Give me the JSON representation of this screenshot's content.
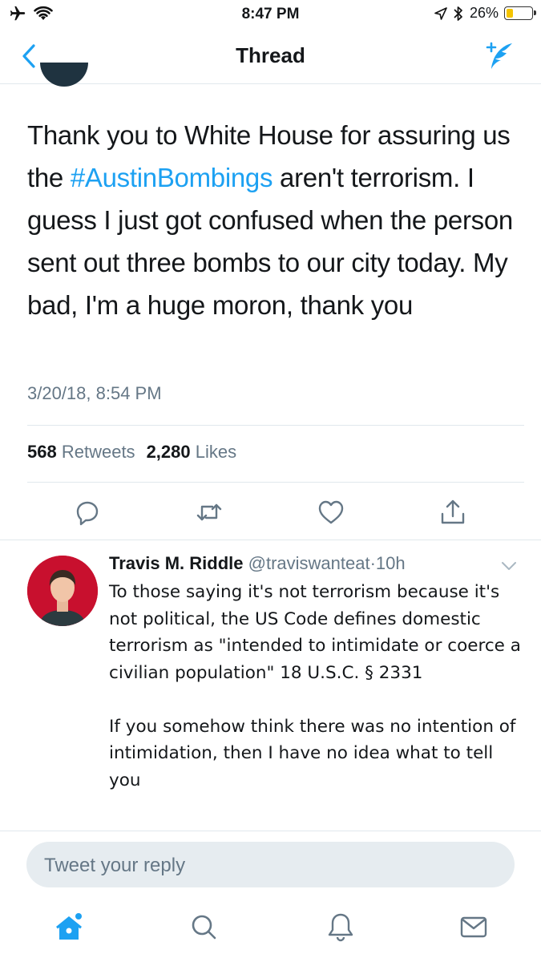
{
  "status_bar": {
    "time": "8:47 PM",
    "battery_text": "26%",
    "battery_level": 0.26,
    "icons": [
      "airplane-icon",
      "wifi-icon",
      "location-icon",
      "bluetooth-icon",
      "battery-icon"
    ]
  },
  "nav": {
    "title": "Thread",
    "back_icon": "chevron-left-icon",
    "compose_icon": "compose-tweet-icon"
  },
  "tweet": {
    "text_before": "Thank you to White House for assuring us the ",
    "hashtag": "#AustinBombings",
    "text_after": " aren't terrorism. I guess I just got confused when the person sent out three bombs to our city today. My bad, I'm a huge moron, thank you",
    "timestamp": "3/20/18, 8:54 PM",
    "retweets_count": "568",
    "retweets_label": "Retweets",
    "likes_count": "2,280",
    "likes_label": "Likes"
  },
  "actions": [
    "reply-icon",
    "retweet-icon",
    "like-icon",
    "share-icon"
  ],
  "reply": {
    "name": "Travis M. Riddle",
    "handle": "@traviswanteat",
    "separator": "·",
    "time": "10h",
    "text": "To those saying it's not terrorism because it's not political, the US Code defines domestic terrorism as \"intended to intimidate or coerce a civilian population\" 18 U.S.C. § 2331\n\nIf you somehow think there was no intention of intimidation, then I have no idea what to tell you"
  },
  "reply_input": {
    "placeholder": "Tweet your reply",
    "value": ""
  },
  "tab_bar": [
    "home-icon",
    "search-icon",
    "notifications-icon",
    "messages-icon"
  ],
  "colors": {
    "accent": "#1da1f2",
    "secondary_text": "#657786",
    "divider": "#e1e8ed",
    "input_bg": "#e6ecf0",
    "battery": "#f5c400"
  }
}
